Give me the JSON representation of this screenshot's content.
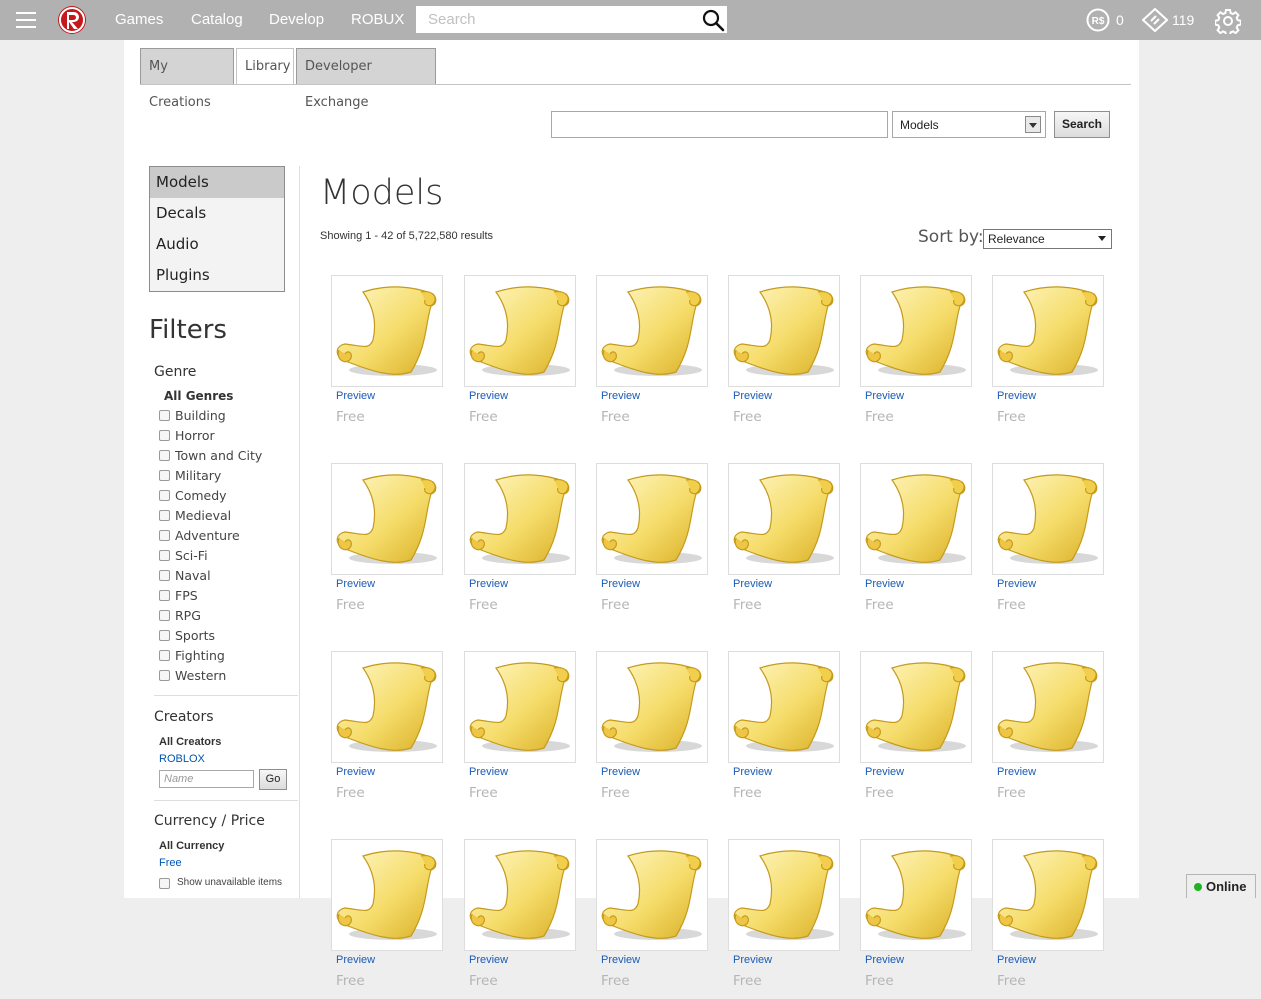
{
  "topnav": {
    "links": [
      "Games",
      "Catalog",
      "Develop",
      "ROBUX"
    ],
    "search_placeholder": "Search",
    "robux": "0",
    "tickets": "119"
  },
  "tabs": [
    "My Creations",
    "Library",
    "Developer Exchange"
  ],
  "active_tab": "Library",
  "library_search": {
    "value": "",
    "type_selected": "Models",
    "button": "Search"
  },
  "categories": [
    "Models",
    "Decals",
    "Audio",
    "Plugins"
  ],
  "active_category": "Models",
  "filters": {
    "title": "Filters",
    "genre_head": "Genre",
    "all_genres": "All Genres",
    "genres": [
      "Building",
      "Horror",
      "Town and City",
      "Military",
      "Comedy",
      "Medieval",
      "Adventure",
      "Sci-Fi",
      "Naval",
      "FPS",
      "RPG",
      "Sports",
      "Fighting",
      "Western"
    ],
    "creators_head": "Creators",
    "all_creators": "All Creators",
    "roblox_link": "ROBLOX",
    "name_placeholder": "Name",
    "go": "Go",
    "currency_head": "Currency / Price",
    "all_currency": "All Currency",
    "free_link": "Free",
    "show_unavailable": "Show unavailable items"
  },
  "results": {
    "title": "Models",
    "count": "Showing 1 - 42 of 5,722,580 results",
    "sort_label": "Sort by:",
    "sort_value": "Relevance",
    "item_preview": "Preview",
    "item_price": "Free"
  },
  "status": {
    "online": "Online"
  },
  "colors": {
    "topbar": "#b1b1b1",
    "link_blue": "#1a5bb5",
    "online_green": "#1fb31f"
  },
  "icons": {
    "menu": "hamburger-icon",
    "logo": "roblox-logo",
    "search": "magnifier-icon",
    "robux": "robux-icon",
    "tickets": "ticket-icon",
    "settings": "gear-icon",
    "model_thumb": "scroll-icon"
  }
}
